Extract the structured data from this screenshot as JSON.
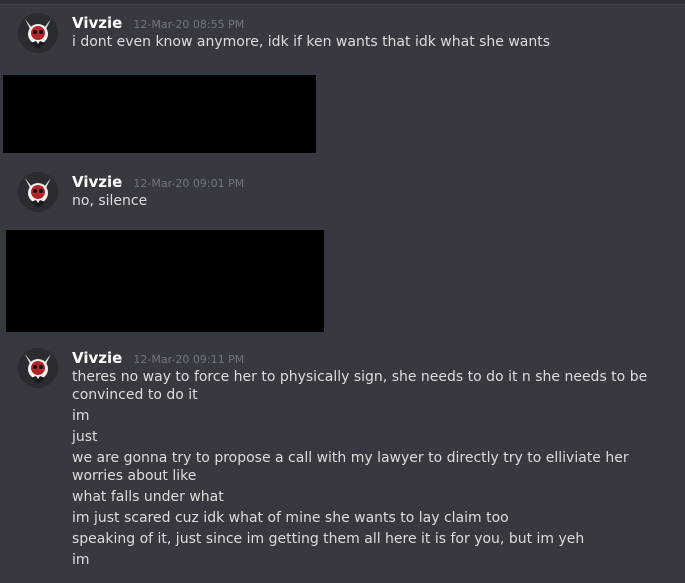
{
  "messages": [
    {
      "username": "Vivzie",
      "timestamp": "12-Mar-20 08:55 PM",
      "lines": [
        "i dont even know anymore, idk if ken wants that idk what she wants"
      ]
    },
    {
      "username": "Vivzie",
      "timestamp": "12-Mar-20 09:01 PM",
      "lines": [
        "no, silence"
      ]
    },
    {
      "username": "Vivzie",
      "timestamp": "12-Mar-20 09:11 PM",
      "lines": [
        "theres no way to force her to physically sign, she needs to do it n she needs to be convinced to do it",
        "im",
        "just",
        "we are gonna try to propose a call with my lawyer to directly try to elliviate her worries about like",
        "what falls under what",
        "im just scared cuz idk what of mine she wants to lay claim too",
        "speaking of it, just since im getting them all here it is for you, but im yeh",
        "im"
      ]
    }
  ]
}
